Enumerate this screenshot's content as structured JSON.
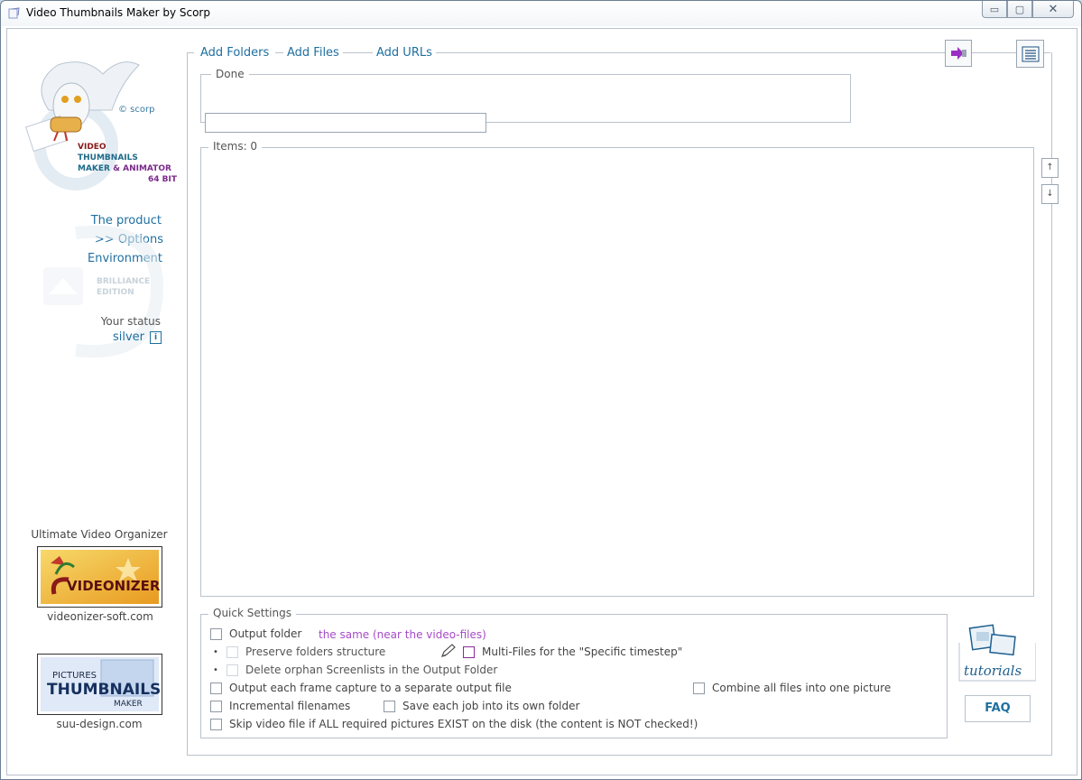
{
  "window": {
    "title": "Video Thumbnails Maker by Scorp",
    "controls": {
      "minimize": "▭",
      "maximize": "▢",
      "close": "✕"
    }
  },
  "sidebar": {
    "logo_copyright": "© scorp",
    "logo_lines": [
      "VIDEO",
      "THUMBNAILS",
      "MAKER",
      "& ANIMATOR",
      "64 BIT"
    ],
    "links": [
      {
        "label": "The product"
      },
      {
        "label": ">> Options"
      },
      {
        "label": "Environment"
      }
    ],
    "watermark_text": [
      "BRILLIANCE",
      "EDITION"
    ],
    "status_label": "Your status",
    "status_value": "silver",
    "info_icon": "i",
    "promo1": {
      "title": "Ultimate Video Organizer",
      "logo_text": "VIDEONIZER",
      "url": "videonizer-soft.com"
    },
    "promo2": {
      "logo_top": "PICTURES",
      "logo_mid": "THUMBNAILS",
      "logo_bottom": "MAKER",
      "url": "suu-design.com"
    }
  },
  "toolbar": {
    "add_folders": "Add Folders",
    "add_files": "Add Files",
    "add_urls": "Add URLs",
    "exit_icon": "exit-arrow-icon",
    "log_icon": "list-icon"
  },
  "status_group": {
    "legend": "Done",
    "progress_percent": 0
  },
  "items_group": {
    "legend": "Items: 0",
    "up_arrow": "↑",
    "down_arrow": "↓"
  },
  "quick_settings": {
    "legend": "Quick Settings",
    "output_folder": "Output folder",
    "output_folder_value": "the same (near the video-files)",
    "preserve_structure": "Preserve folders structure",
    "multi_files": "Multi-Files for the \"Specific timestep\"",
    "delete_orphan": "Delete orphan Screenlists in the Output Folder",
    "output_each_frame": "Output each frame capture to a separate output file",
    "combine_all": "Combine all files into one picture",
    "incremental": "Incremental filenames",
    "save_each_job": "Save each job into its own folder",
    "skip_video": "Skip video file if ALL required pictures EXIST on the disk (the content is NOT checked!)"
  },
  "help": {
    "tutorials": "tutorials",
    "faq": "FAQ"
  },
  "colors": {
    "link": "#1e6f9f",
    "accent_purple": "#a64bc8",
    "border": "#b9c2cc"
  }
}
